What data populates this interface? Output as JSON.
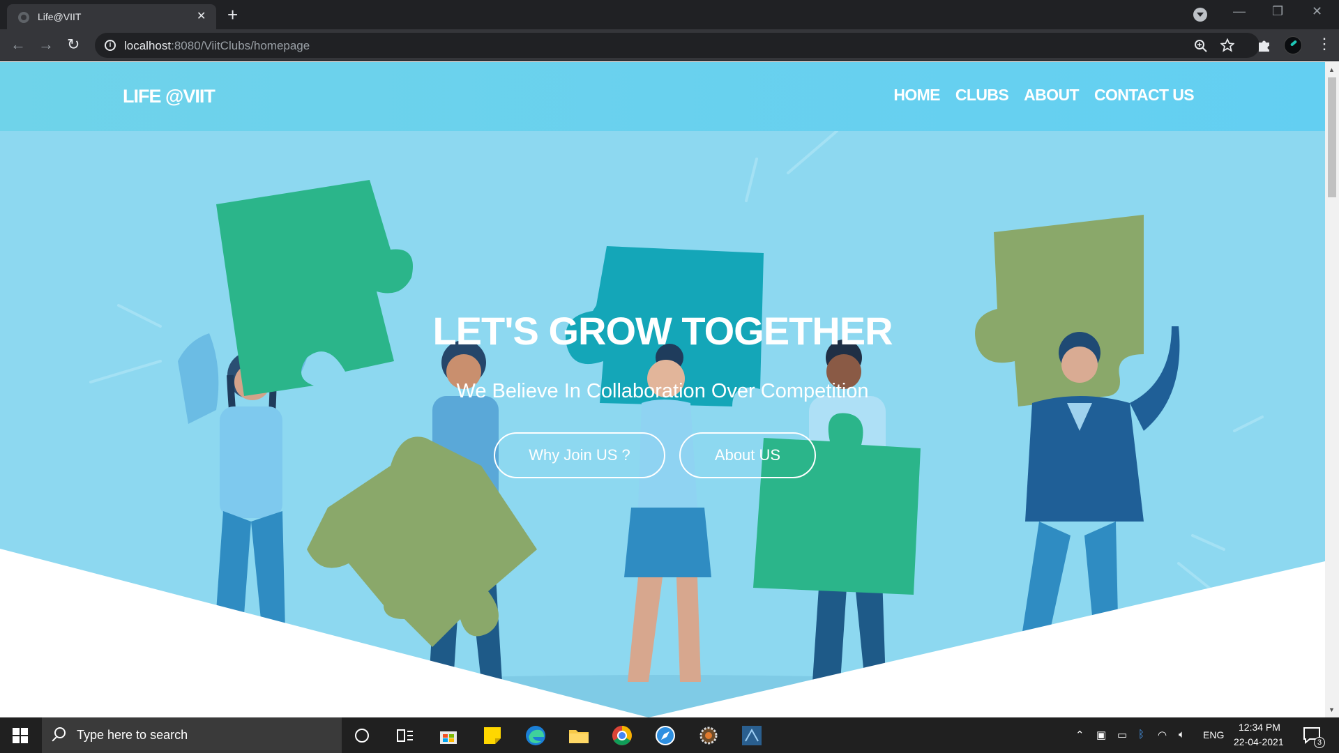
{
  "browser": {
    "tab_title": "Life@VIIT",
    "tab_close": "✕",
    "new_tab": "+",
    "url_host": "localhost",
    "url_path": ":8080/ViitClubs/homepage",
    "back": "←",
    "forward": "→",
    "reload": "↻",
    "zoom_icon": "zoom-icon",
    "star_icon": "star-icon",
    "extensions_icon": "puzzle-icon",
    "menu": "⋮",
    "win_min": "—",
    "win_restore": "❐",
    "win_close": "✕"
  },
  "site": {
    "brand": "LIFE @VIIT",
    "nav": [
      {
        "label": "HOME"
      },
      {
        "label": "CLUBS"
      },
      {
        "label": "ABOUT"
      },
      {
        "label": "CONTACT US"
      }
    ],
    "hero": {
      "title": "LET'S GROW TOGETHER",
      "subtitle": "We Believe In Collaboration Over Competition",
      "primary_button": "Why Join US ?",
      "secondary_button": "About US"
    }
  },
  "taskbar": {
    "search_placeholder": "Type here to search",
    "language": "ENG",
    "time": "12:34 PM",
    "date": "22-04-2021",
    "notifications": "3"
  },
  "colors": {
    "hero_background": "#8dd8f0",
    "navbar": "#66d1ef",
    "puzzle_green": "#2bb58a",
    "puzzle_teal": "#14a6b8",
    "puzzle_olive": "#8aa86a"
  }
}
